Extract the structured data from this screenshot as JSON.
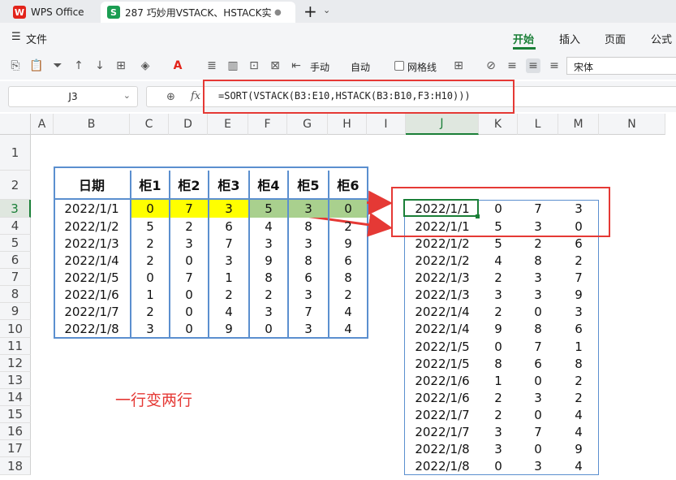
{
  "app": {
    "wps_tab": "WPS Office",
    "doc_tab": "287 巧妙用VSTACK、HSTACK实",
    "new_tab": "+"
  },
  "menu": {
    "file": "文件",
    "home": "开始",
    "insert": "插入",
    "page": "页面",
    "formula": "公式"
  },
  "toolbar": {
    "handmade": "手动",
    "auto": "自动",
    "gridlines": "网格线",
    "font": "宋体"
  },
  "formula_bar": {
    "cell_ref": "J3",
    "fx": "fx",
    "formula": "=SORT(VSTACK(B3:E10,HSTACK(B3:B10,F3:H10)))"
  },
  "columns": [
    "A",
    "B",
    "C",
    "D",
    "E",
    "F",
    "G",
    "H",
    "I",
    "J",
    "K",
    "L",
    "M",
    "N"
  ],
  "rows": [
    "1",
    "2",
    "3",
    "4",
    "5",
    "6",
    "7",
    "8",
    "9",
    "10",
    "11",
    "12",
    "13",
    "14",
    "15",
    "16",
    "17",
    "18"
  ],
  "source_table": {
    "headers": [
      "日期",
      "柜1",
      "柜2",
      "柜3",
      "柜4",
      "柜5",
      "柜6"
    ],
    "rows": [
      [
        "2022/1/1",
        "0",
        "7",
        "3",
        "5",
        "3",
        "0"
      ],
      [
        "2022/1/2",
        "5",
        "2",
        "6",
        "4",
        "8",
        "2"
      ],
      [
        "2022/1/3",
        "2",
        "3",
        "7",
        "3",
        "3",
        "9"
      ],
      [
        "2022/1/4",
        "2",
        "0",
        "3",
        "9",
        "8",
        "6"
      ],
      [
        "2022/1/5",
        "0",
        "7",
        "1",
        "8",
        "6",
        "8"
      ],
      [
        "2022/1/6",
        "1",
        "0",
        "2",
        "2",
        "3",
        "2"
      ],
      [
        "2022/1/7",
        "2",
        "0",
        "4",
        "3",
        "7",
        "4"
      ],
      [
        "2022/1/8",
        "3",
        "0",
        "9",
        "0",
        "3",
        "4"
      ]
    ]
  },
  "result_table": {
    "rows": [
      [
        "2022/1/1",
        "0",
        "7",
        "3"
      ],
      [
        "2022/1/1",
        "5",
        "3",
        "0"
      ],
      [
        "2022/1/2",
        "5",
        "2",
        "6"
      ],
      [
        "2022/1/2",
        "4",
        "8",
        "2"
      ],
      [
        "2022/1/3",
        "2",
        "3",
        "7"
      ],
      [
        "2022/1/3",
        "3",
        "3",
        "9"
      ],
      [
        "2022/1/4",
        "2",
        "0",
        "3"
      ],
      [
        "2022/1/4",
        "9",
        "8",
        "6"
      ],
      [
        "2022/1/5",
        "0",
        "7",
        "1"
      ],
      [
        "2022/1/5",
        "8",
        "6",
        "8"
      ],
      [
        "2022/1/6",
        "1",
        "0",
        "2"
      ],
      [
        "2022/1/6",
        "2",
        "3",
        "2"
      ],
      [
        "2022/1/7",
        "2",
        "0",
        "4"
      ],
      [
        "2022/1/7",
        "3",
        "7",
        "4"
      ],
      [
        "2022/1/8",
        "3",
        "0",
        "9"
      ],
      [
        "2022/1/8",
        "0",
        "3",
        "4"
      ]
    ]
  },
  "annotation": "一行变两行",
  "colors": {
    "highlight_yellow": "#ffff00",
    "highlight_green": "#a9d08e",
    "annotation_red": "#e53935",
    "table_border": "#5b8fcf",
    "accent_green": "#1a7f37"
  }
}
